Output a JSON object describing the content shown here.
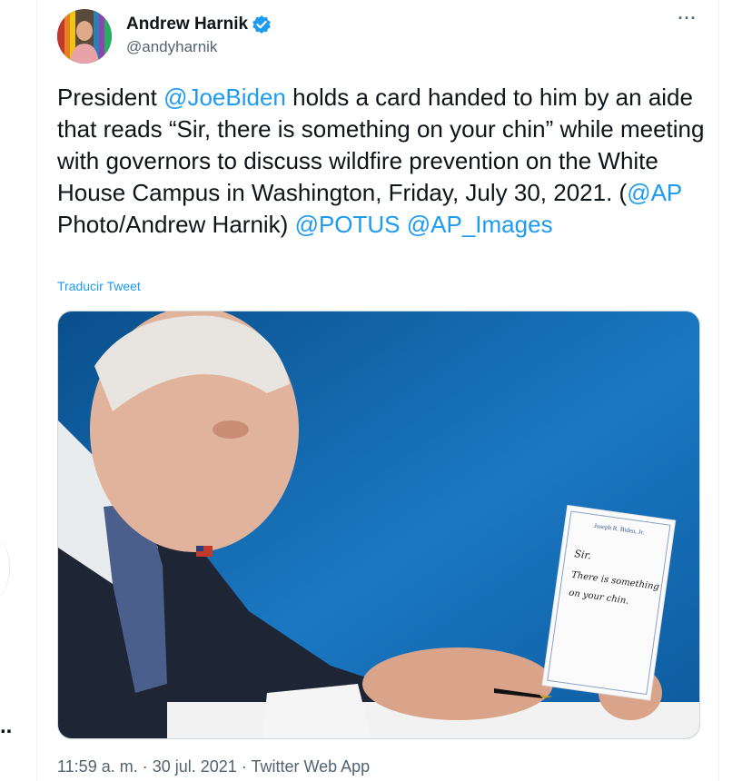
{
  "author": {
    "display_name": "Andrew Harnik",
    "handle": "@andyharnik",
    "verified": true
  },
  "tweet": {
    "parts": [
      {
        "type": "text",
        "text": "President "
      },
      {
        "type": "link",
        "text": "@JoeBiden"
      },
      {
        "type": "text",
        "text": " holds a card handed to him by an aide that reads “Sir, there is something on your chin” while meeting with governors to discuss wildfire prevention on the White House Campus in Washington, Friday, July 30, 2021. ("
      },
      {
        "type": "link",
        "text": "@AP"
      },
      {
        "type": "text",
        "text": " Photo/Andrew Harnik) "
      },
      {
        "type": "link",
        "text": "@POTUS"
      },
      {
        "type": "text",
        "text": " "
      },
      {
        "type": "link",
        "text": "@AP_Images"
      }
    ],
    "translate_label": "Traducir Tweet",
    "more_label": "···"
  },
  "media": {
    "card_header": "Joseph R. Biden, Jr.",
    "card_line1": "Sir.",
    "card_line2": "There is something",
    "card_line3": "on your chin."
  },
  "meta": {
    "time": "11:59 a. m.",
    "sep1": " · ",
    "date": "30 jul. 2021",
    "sep2": " · ",
    "source": "Twitter Web App"
  },
  "colors": {
    "link": "#1d9bf0",
    "secondary_text": "#536471",
    "background_blue": "#1a73b8"
  },
  "icons": {
    "verified": "verified-badge-icon",
    "more": "more-options-icon"
  }
}
